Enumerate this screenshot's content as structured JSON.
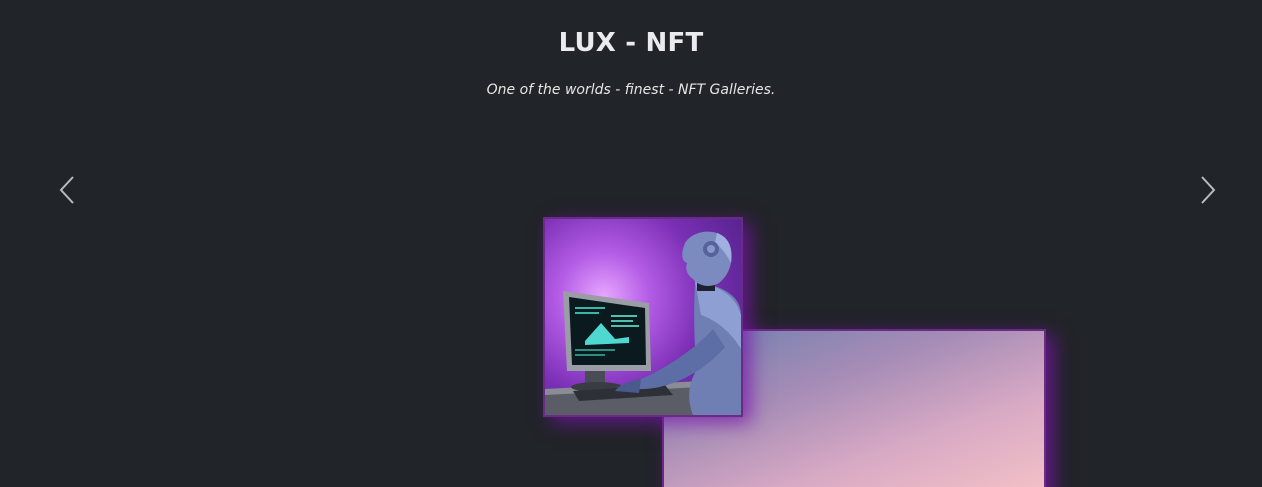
{
  "header": {
    "title": "LUX - NFT",
    "subtitle": "One of the worlds - finest - NFT Galleries."
  },
  "carousel": {
    "prev_icon": "chevron-left-icon",
    "next_icon": "chevron-right-icon"
  },
  "gallery": {
    "cards": [
      {
        "name": "robot-at-computer-artwork"
      },
      {
        "name": "gradient-artwork"
      }
    ]
  },
  "colors": {
    "background": "#212428",
    "card_border": "#6a2a85",
    "card_glow": "#7814aa"
  }
}
